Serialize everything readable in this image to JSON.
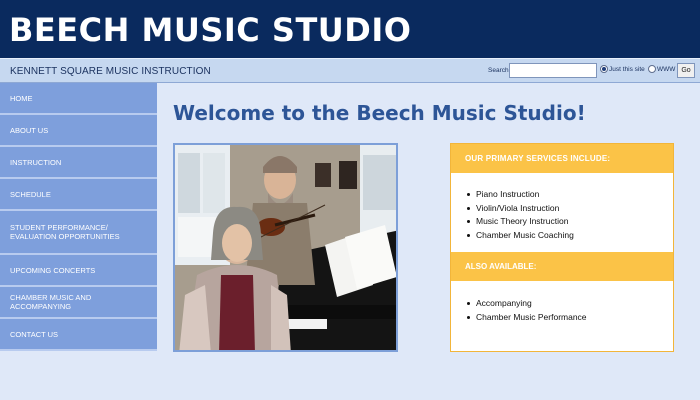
{
  "header": {
    "title": "BEECH MUSIC STUDIO",
    "tagline": "KENNETT SQUARE MUSIC INSTRUCTION"
  },
  "search": {
    "label": "Search:",
    "value": "",
    "option_site": "Just this site",
    "option_www": "WWW",
    "go_label": "Go"
  },
  "sidebar": {
    "items": [
      {
        "label": "HOME"
      },
      {
        "label": "ABOUT US"
      },
      {
        "label": "INSTRUCTION"
      },
      {
        "label": "SCHEDULE"
      },
      {
        "label": "STUDENT PERFORMANCE/ EVALUATION OPPORTUNITIES"
      },
      {
        "label": "UPCOMING CONCERTS"
      },
      {
        "label": "CHAMBER MUSIC AND ACCOMPANYING"
      },
      {
        "label": "CONTACT US"
      }
    ]
  },
  "main": {
    "title": "Welcome to the Beech Music Studio!",
    "photo_icon": "photo-icon"
  },
  "services": {
    "primary_header": "OUR PRIMARY SERVICES INCLUDE:",
    "primary_items": [
      "Piano Instruction",
      "Violin/Viola Instruction",
      "Music Theory Instruction",
      "Chamber Music Coaching"
    ],
    "also_header": "ALSO AVAILABLE:",
    "also_items": [
      "Accompanying",
      "Chamber Music Performance"
    ]
  },
  "colors": {
    "header_bg": "#0a2a5e",
    "nav_bg": "#7e9fdc",
    "accent": "#fbc347",
    "title": "#2d5597"
  }
}
